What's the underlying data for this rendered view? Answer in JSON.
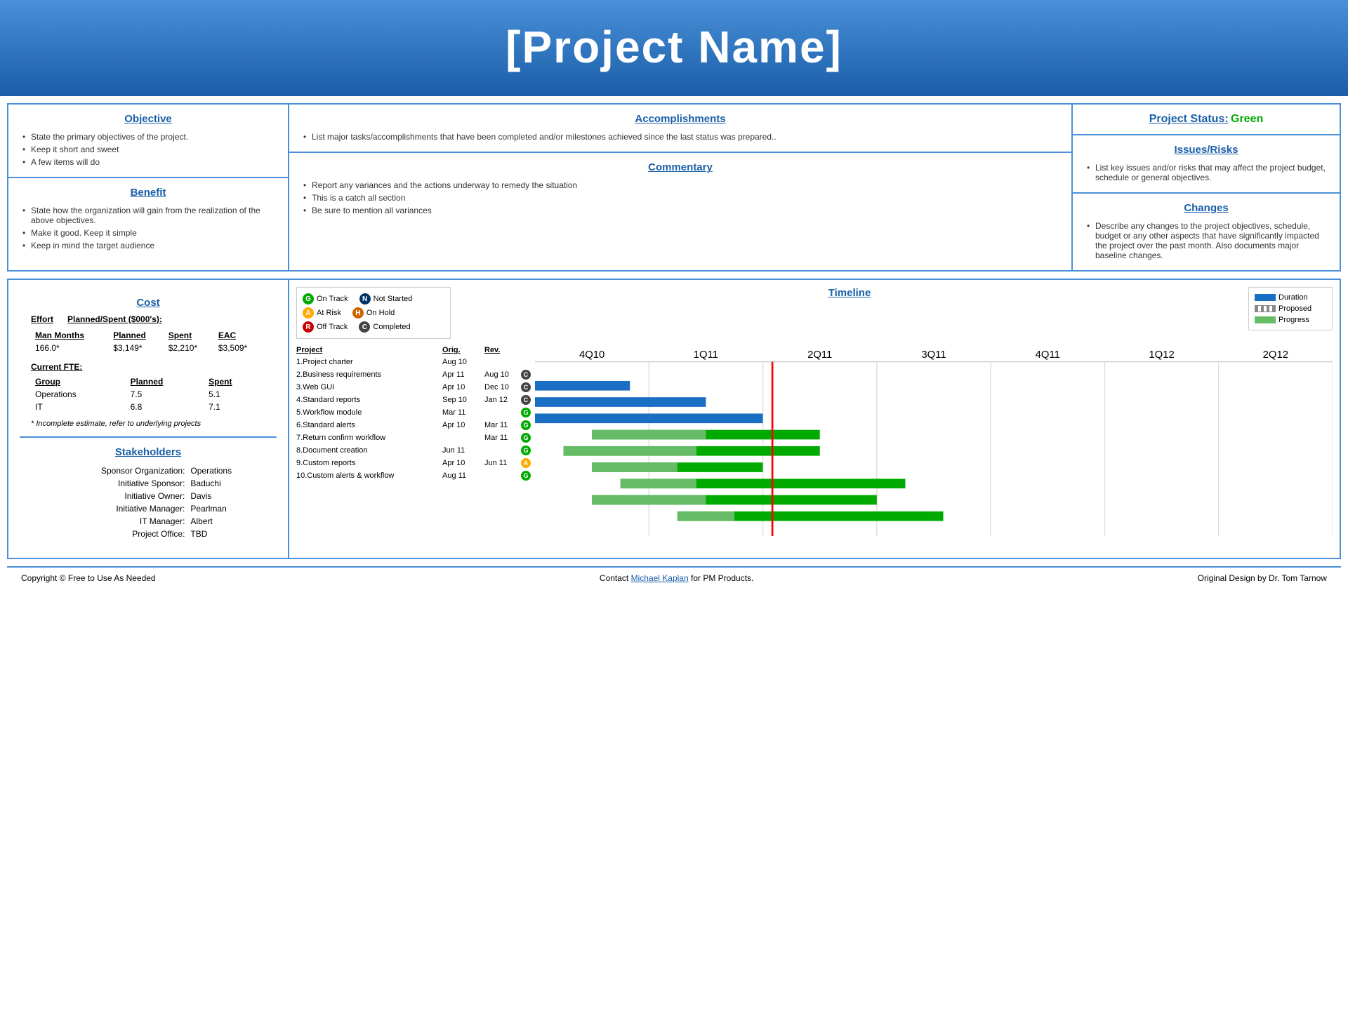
{
  "header": {
    "title": "[Project Name]"
  },
  "objective": {
    "title": "Objective",
    "items": [
      "State the primary objectives  of the project.",
      "Keep it short and sweet",
      "A few items will do"
    ]
  },
  "benefit": {
    "title": "Benefit",
    "items": [
      "State how the organization will gain from the realization of the above  objectives.",
      "Make it good. Keep it simple",
      "Keep in mind the target audience"
    ]
  },
  "accomplishments": {
    "title": "Accomplishments",
    "items": [
      "List major tasks/accomplishments that have  been completed and/or milestones achieved  since the last status was prepared.."
    ]
  },
  "commentary": {
    "title": "Commentary",
    "items": [
      "Report any variances  and the actions underway to remedy the situation",
      "This is a catch all section",
      "Be  sure to mention all variances"
    ]
  },
  "project_status": {
    "title": "Project Status:",
    "value": "Green"
  },
  "issues_risks": {
    "title": "Issues/Risks",
    "items": [
      "List key issues and/or risks that may affect the project budget, schedule or general objectives."
    ]
  },
  "changes": {
    "title": "Changes",
    "items": [
      "Describe any changes to the project objectives, schedule, budget or any other aspects that have significantly impacted the project over the past month. Also documents major baseline  changes."
    ]
  },
  "cost": {
    "title": "Cost",
    "effort_label": "Effort",
    "planned_spent_label": "Planned/Spent ($000's):",
    "columns": [
      "Man Months",
      "Planned",
      "Spent",
      "EAC"
    ],
    "row": [
      "166.0*",
      "$3,149*",
      "$2,210*",
      "$3,509*"
    ],
    "current_fte_label": "Current FTE:",
    "fte_columns": [
      "Group",
      "Planned",
      "Spent"
    ],
    "fte_rows": [
      [
        "Operations",
        "7.5",
        "5.1"
      ],
      [
        "IT",
        "6.8",
        "7.1"
      ]
    ],
    "footnote": "* Incomplete estimate, refer to underlying projects"
  },
  "stakeholders": {
    "title": "Stakeholders",
    "rows": [
      {
        "label": "Sponsor Organization:",
        "value": "Operations"
      },
      {
        "label": "Initiative Sponsor:",
        "value": "Baduchi"
      },
      {
        "label": "Initiative Owner:",
        "value": "Davis"
      },
      {
        "label": "Initiative Manager:",
        "value": "Pearlman"
      },
      {
        "label": "IT Manager:",
        "value": "Albert"
      },
      {
        "label": "Project Office:",
        "value": "TBD"
      }
    ]
  },
  "legend": {
    "items": [
      {
        "symbol": "G",
        "color": "circle-green",
        "label": "On Track"
      },
      {
        "symbol": "N",
        "color": "circle-navy",
        "label": "Not Started"
      },
      {
        "symbol": "A",
        "color": "circle-yellow",
        "label": "At Risk"
      },
      {
        "symbol": "H",
        "color": "circle-orange",
        "label": "On Hold"
      },
      {
        "symbol": "R",
        "color": "circle-red",
        "label": "Off Track"
      },
      {
        "symbol": "C",
        "color": "circle-gray",
        "label": "Completed"
      }
    ]
  },
  "timeline": {
    "title": "Timeline",
    "legend": [
      {
        "type": "solid-green",
        "label": "Duration"
      },
      {
        "type": "dashed",
        "label": "Proposed"
      },
      {
        "type": "progress",
        "label": "Progress"
      }
    ],
    "columns": [
      "Project",
      "Orig.",
      "Rev."
    ],
    "quarter_labels": [
      "4Q10",
      "1Q11",
      "2Q11",
      "3Q11",
      "4Q11",
      "1Q12",
      "2Q12"
    ],
    "rows": [
      {
        "name": "1.Project charter",
        "orig": "Aug 10",
        "rev": "",
        "status": "",
        "bars": []
      },
      {
        "name": "2.Business requirements",
        "orig": "Apr 11",
        "rev": "Aug 10",
        "status": "C",
        "bars": [
          {
            "type": "blue",
            "start": 0,
            "width": 1.2
          }
        ]
      },
      {
        "name": "3.Web GUI",
        "orig": "Apr 10",
        "rev": "Dec 10",
        "status": "C",
        "bars": [
          {
            "type": "blue",
            "start": 0,
            "width": 1.8
          }
        ]
      },
      {
        "name": "4.Standard reports",
        "orig": "Sep 10",
        "rev": "Jan 12",
        "status": "C",
        "bars": [
          {
            "type": "blue",
            "start": 0,
            "width": 2.5
          }
        ]
      },
      {
        "name": "5.Workflow module",
        "orig": "Mar 11",
        "rev": "",
        "status": "G",
        "bars": [
          {
            "type": "green",
            "start": 0.5,
            "width": 2
          }
        ]
      },
      {
        "name": "6.Standard alerts",
        "orig": "Apr 10",
        "rev": "Mar 11",
        "status": "G",
        "bars": [
          {
            "type": "green",
            "start": 0.3,
            "width": 2.2
          }
        ]
      },
      {
        "name": "7.Return confirm workflow",
        "orig": "",
        "rev": "Mar 11",
        "status": "G",
        "bars": [
          {
            "type": "green",
            "start": 0.5,
            "width": 1.5
          }
        ]
      },
      {
        "name": "8.Document creation",
        "orig": "Jun 11",
        "rev": "",
        "status": "G",
        "bars": [
          {
            "type": "green",
            "start": 0.8,
            "width": 2.5
          }
        ]
      },
      {
        "name": "9.Custom reports",
        "orig": "Apr 10",
        "rev": "Jun 11",
        "status": "A",
        "bars": [
          {
            "type": "green",
            "start": 0.5,
            "width": 2.5
          }
        ]
      },
      {
        "name": "10.Custom alerts & workflow",
        "orig": "Aug 11",
        "rev": "",
        "status": "G",
        "bars": [
          {
            "type": "green",
            "start": 1.2,
            "width": 2.2
          }
        ]
      }
    ]
  },
  "footer": {
    "copyright": "Copyright  ©  Free to  Use As Needed",
    "contact_prefix": "Contact ",
    "contact_link": "Michael Kaplan",
    "contact_suffix": " for PM Products.",
    "original_design": "Original Design by Dr. Tom Tarnow"
  }
}
